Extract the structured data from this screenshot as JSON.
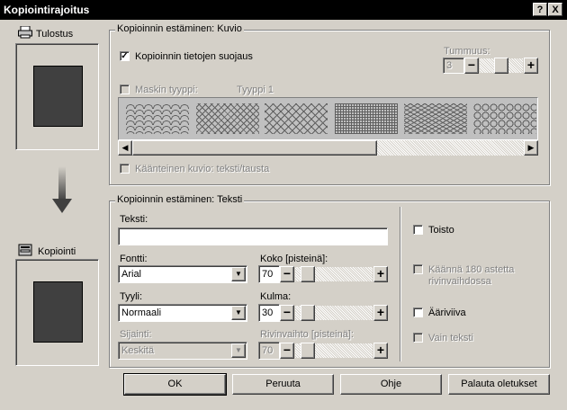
{
  "window": {
    "title": "Kopiointirajoitus",
    "help_btn": "?",
    "close_btn": "X"
  },
  "left": {
    "tulostus_label": "Tulostus",
    "kopiointi_label": "Kopiointi"
  },
  "pattern": {
    "legend": "Kopioinnin estäminen: Kuvio",
    "protect_label": "Kopioinnin tietojen suojaus",
    "tummuus_label": "Tummuus:",
    "tummuus_value": "3",
    "mask_label": "Maskin tyyppi:",
    "mask_value": "Tyyppi 1",
    "inverse_label": "Käänteinen kuvio: teksti/tausta"
  },
  "text": {
    "legend": "Kopioinnin estäminen: Teksti",
    "teksti_label": "Teksti:",
    "teksti_value": "",
    "fontti_label": "Fontti:",
    "fontti_value": "Arial",
    "koko_label": "Koko [pisteinä]:",
    "koko_value": "70",
    "tyyli_label": "Tyyli:",
    "tyyli_value": "Normaali",
    "kulma_label": "Kulma:",
    "kulma_value": "30",
    "sijainti_label": "Sijainti:",
    "sijainti_value": "Keskitä",
    "rivinvaihto_label": "Rivinvaihto [pisteinä]:",
    "rivinvaihto_value": "70",
    "toisto_label": "Toisto",
    "kaanna_label_1": "Käännä 180 astetta",
    "kaanna_label_2": "rivinvaihdossa",
    "aariviiva_label": "Ääriviiva",
    "vain_teksti_label": "Vain teksti"
  },
  "buttons": {
    "ok": "OK",
    "cancel": "Peruuta",
    "help": "Ohje",
    "defaults": "Palauta oletukset"
  }
}
